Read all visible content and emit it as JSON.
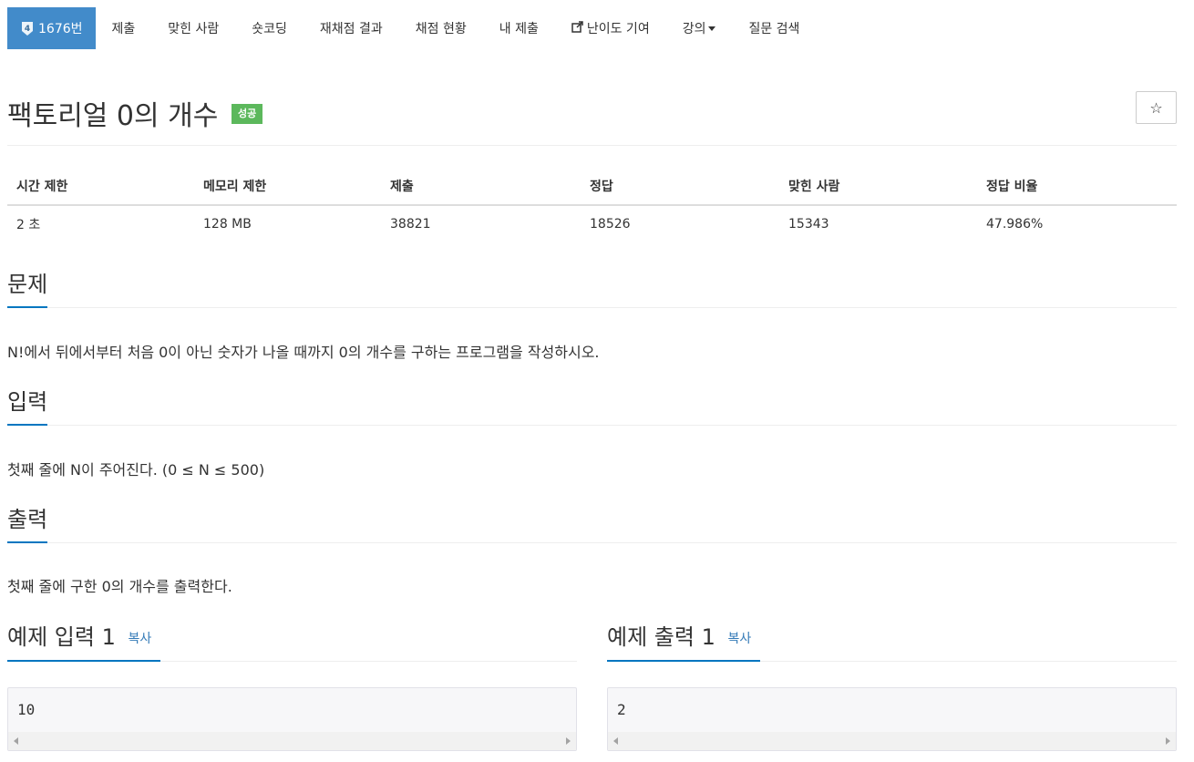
{
  "nav": {
    "active_label": "1676번",
    "tier_level": "4",
    "items": [
      "제출",
      "맞힌 사람",
      "숏코딩",
      "재채점 결과",
      "채점 현황",
      "내 제출",
      "난이도 기여",
      "강의",
      "질문 검색"
    ]
  },
  "problem": {
    "title": "팩토리얼 0의 개수",
    "status": "성공",
    "star": "☆"
  },
  "info_table": {
    "headers": [
      "시간 제한",
      "메모리 제한",
      "제출",
      "정답",
      "맞힌 사람",
      "정답 비율"
    ],
    "values": [
      "2 초",
      "128 MB",
      "38821",
      "18526",
      "15343",
      "47.986%"
    ]
  },
  "sections": {
    "description": {
      "title": "문제",
      "text": "N!에서 뒤에서부터 처음 0이 아닌 숫자가 나올 때까지 0의 개수를 구하는 프로그램을 작성하시오."
    },
    "input": {
      "title": "입력",
      "text": "첫째 줄에 N이 주어진다. (0 ≤ N ≤ 500)"
    },
    "output": {
      "title": "출력",
      "text": "첫째 줄에 구한 0의 개수를 출력한다."
    }
  },
  "samples": {
    "input": {
      "title": "예제 입력 1",
      "copy": "복사",
      "value": "10"
    },
    "output": {
      "title": "예제 출력 1",
      "copy": "복사",
      "value": "2"
    }
  },
  "colors": {
    "accent": "#428bca",
    "success": "#5cb85c",
    "underline": "#0076c0",
    "link": "#337ab7"
  }
}
